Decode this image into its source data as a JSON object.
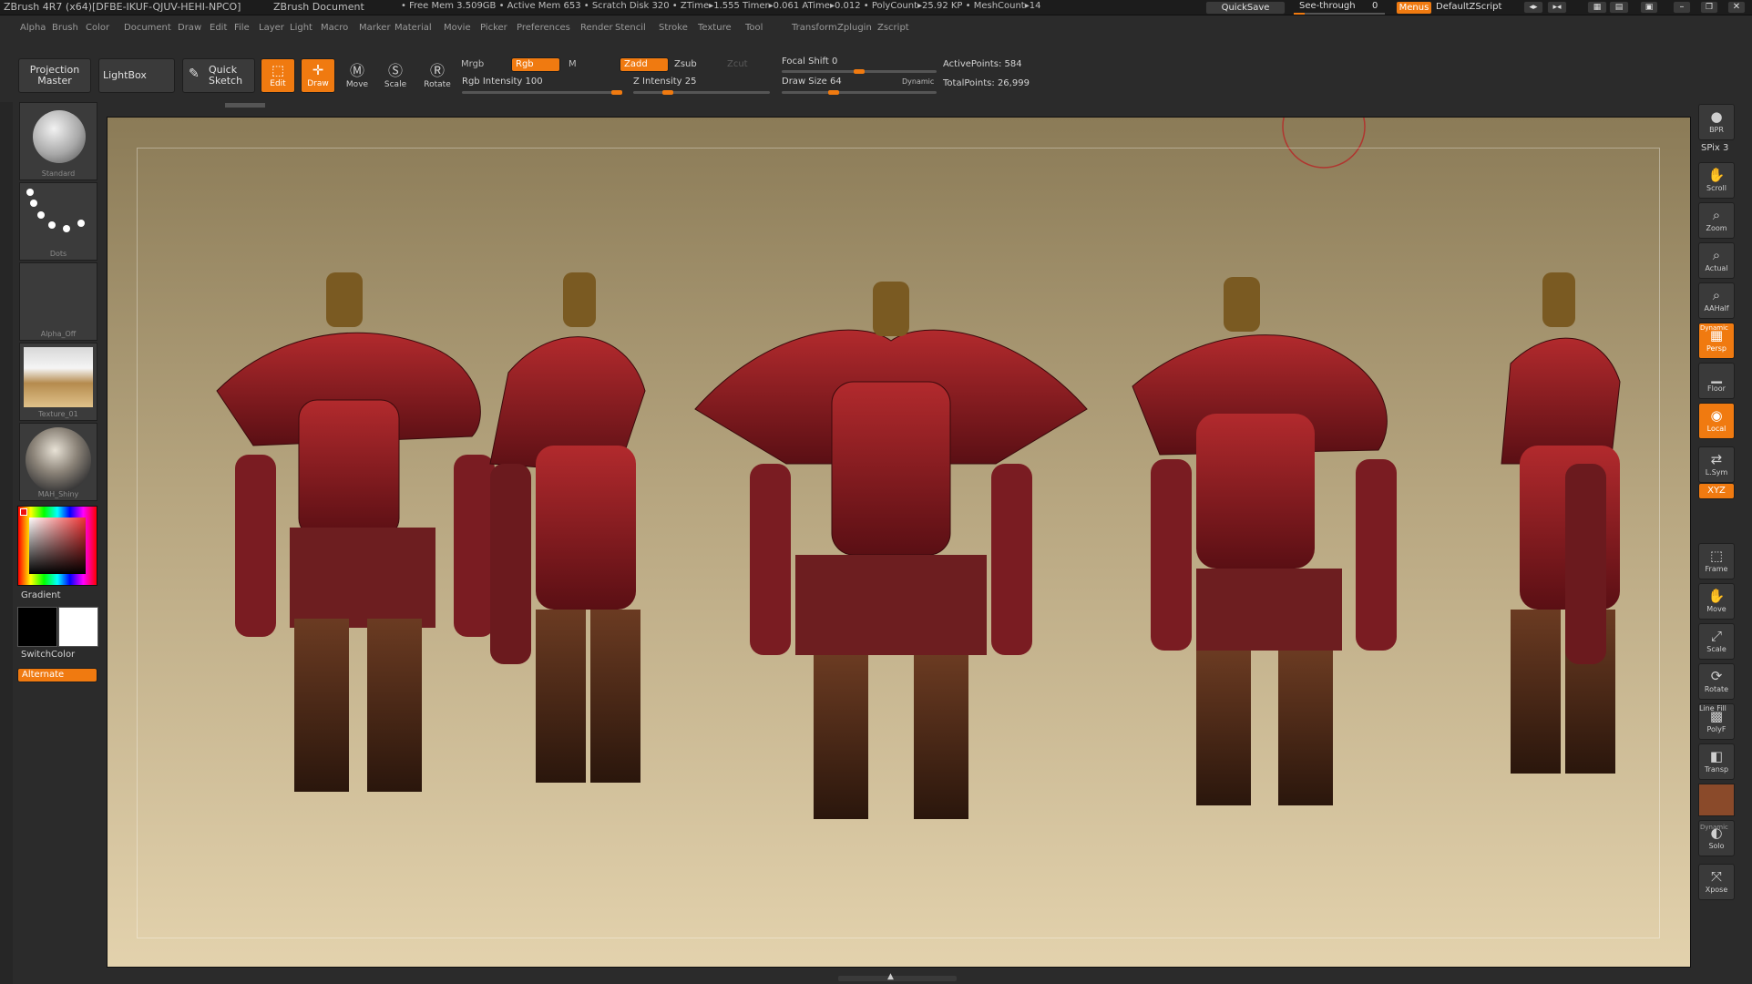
{
  "title_bar": {
    "app": "ZBrush 4R7 (x64)[DFBE-IKUF-QJUV-HEHI-NPCO]",
    "doc": "ZBrush Document",
    "stats": "• Free Mem 3.509GB • Active Mem 653 • Scratch Disk 320 • ZTime▸1.555 Timer▸0.061 ATime▸0.012 • PolyCount▸25.92 KP • MeshCount▸14",
    "quicksave": "QuickSave",
    "see_through": "See-through",
    "see_through_value": "0",
    "menus": "Menus",
    "default_zscript": "DefaultZScript"
  },
  "menu_items": [
    "Alpha",
    "Brush",
    "Color",
    "Document",
    "Draw",
    "Edit",
    "File",
    "Layer",
    "Light",
    "Macro",
    "Marker",
    "Material",
    "Movie",
    "Picker",
    "Preferences",
    "Render",
    "Stencil",
    "Stroke",
    "Texture",
    "Tool",
    "Transform",
    "Zplugin",
    "Zscript"
  ],
  "shelf": {
    "projection_master": "Projection Master",
    "lightbox": "LightBox",
    "quick_sketch": "Quick Sketch",
    "edit": "Edit",
    "draw": "Draw",
    "move": "Move",
    "scale": "Scale",
    "rotate": "Rotate",
    "mrgb": "Mrgb",
    "rgb": "Rgb",
    "m": "M",
    "zadd": "Zadd",
    "zsub": "Zsub",
    "zcut": "Zcut",
    "rgb_intensity": "Rgb Intensity 100",
    "z_intensity": "Z Intensity 25",
    "focal_shift": "Focal Shift 0",
    "draw_size": "Draw Size 64",
    "dynamic": "Dynamic",
    "active_points": "ActivePoints: 584",
    "total_points": "TotalPoints: 26,999",
    "rgb_intensity_value": 100,
    "z_intensity_value": 25,
    "focal_shift_value": 0,
    "draw_size_value": 64
  },
  "left_tray": {
    "brush": "Standard",
    "stroke": "Dots",
    "alpha": "Alpha_Off",
    "texture": "Texture_01",
    "material": "MAH_Shiny",
    "gradient": "Gradient",
    "switch_color": "SwitchColor",
    "alternate": "Alternate"
  },
  "right_tray": [
    {
      "id": "bpr",
      "label": "BPR",
      "icon": "sphere-icon"
    },
    {
      "id": "scroll",
      "label": "Scroll",
      "icon": "hand-icon"
    },
    {
      "id": "zoom",
      "label": "Zoom",
      "icon": "magnifier-icon"
    },
    {
      "id": "actual",
      "label": "Actual",
      "icon": "magnifier-icon"
    },
    {
      "id": "aahalf",
      "label": "AAHalf",
      "icon": "magnifier-icon"
    },
    {
      "id": "persp",
      "label": "Persp",
      "icon": "grid-icon"
    },
    {
      "id": "floor",
      "label": "Floor",
      "icon": "floor-icon"
    },
    {
      "id": "local",
      "label": "Local",
      "icon": "local-icon"
    },
    {
      "id": "lsym",
      "label": "L.Sym",
      "icon": "symmetry-icon"
    },
    {
      "id": "xyz",
      "label": "XYZ",
      "icon": "axis-icon"
    },
    {
      "id": "frame",
      "label": "Frame",
      "icon": "frame-icon"
    },
    {
      "id": "move",
      "label": "Move",
      "icon": "hand-icon"
    },
    {
      "id": "scale",
      "label": "Scale",
      "icon": "scale-icon"
    },
    {
      "id": "rotate",
      "label": "Rotate",
      "icon": "rotate-icon"
    },
    {
      "id": "polyf",
      "label": "PolyF",
      "icon": "polyframe-icon"
    },
    {
      "id": "transp",
      "label": "Transp",
      "icon": "transparency-icon"
    },
    {
      "id": "solo",
      "label": "Solo",
      "icon": "solo-icon"
    },
    {
      "id": "xpose",
      "label": "Xpose",
      "icon": "xpose-icon"
    }
  ],
  "right_misc": {
    "spix": "SPix 3",
    "dynamic": "Dynamic",
    "line_fill": "Line Fill"
  },
  "colors": {
    "accent": "#f07a10",
    "panel": "#2b2b2b",
    "canvas_top": "#8b7b57",
    "canvas_bottom": "#e3d2ad",
    "armor_red": "#9a1f24"
  }
}
